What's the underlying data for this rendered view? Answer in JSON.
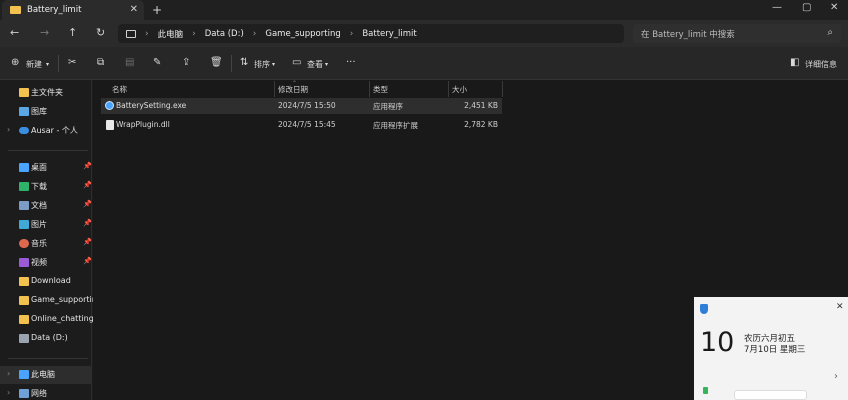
{
  "window": {
    "tab_title": "Battery_limit",
    "new_tab": "+",
    "tab_close": "✕",
    "min": "—",
    "max": "▢",
    "close": "✕"
  },
  "address": {
    "crumbs": [
      "此电脑",
      "Data (D:)",
      "Game_supporting",
      "Battery_limit"
    ],
    "search_placeholder": "在 Battery_limit 中搜索"
  },
  "toolbar": {
    "new_label": "新建",
    "sort_label": "排序",
    "view_label": "查看",
    "more": "···",
    "details_label": "详细信息"
  },
  "sidebar": {
    "items": [
      {
        "label": "主文件夹"
      },
      {
        "label": "图库"
      },
      {
        "label": "Ausar - 个人"
      },
      {
        "label": "桌面"
      },
      {
        "label": "下载"
      },
      {
        "label": "文档"
      },
      {
        "label": "图片"
      },
      {
        "label": "音乐"
      },
      {
        "label": "视频"
      },
      {
        "label": "Download"
      },
      {
        "label": "Game_supporting"
      },
      {
        "label": "Online_chatting"
      },
      {
        "label": "Data (D:)"
      },
      {
        "label": "此电脑"
      },
      {
        "label": "网络"
      }
    ]
  },
  "columns": {
    "name": "名称",
    "modified": "修改日期",
    "type": "类型",
    "size": "大小"
  },
  "files": [
    {
      "name": "BatterySetting.exe",
      "modified": "2024/7/5 15:50",
      "type": "应用程序",
      "size": "2,451 KB"
    },
    {
      "name": "WrapPlugin.dll",
      "modified": "2024/7/5 15:45",
      "type": "应用程序扩展",
      "size": "2,782 KB"
    }
  ],
  "notification": {
    "day": "10",
    "lunar": "农历六月初五",
    "date": "7月10日 星期三",
    "close": "✕",
    "chevron": "›"
  },
  "colors": {
    "folder": "#f2c14e",
    "accent": "#4aa3ff"
  }
}
